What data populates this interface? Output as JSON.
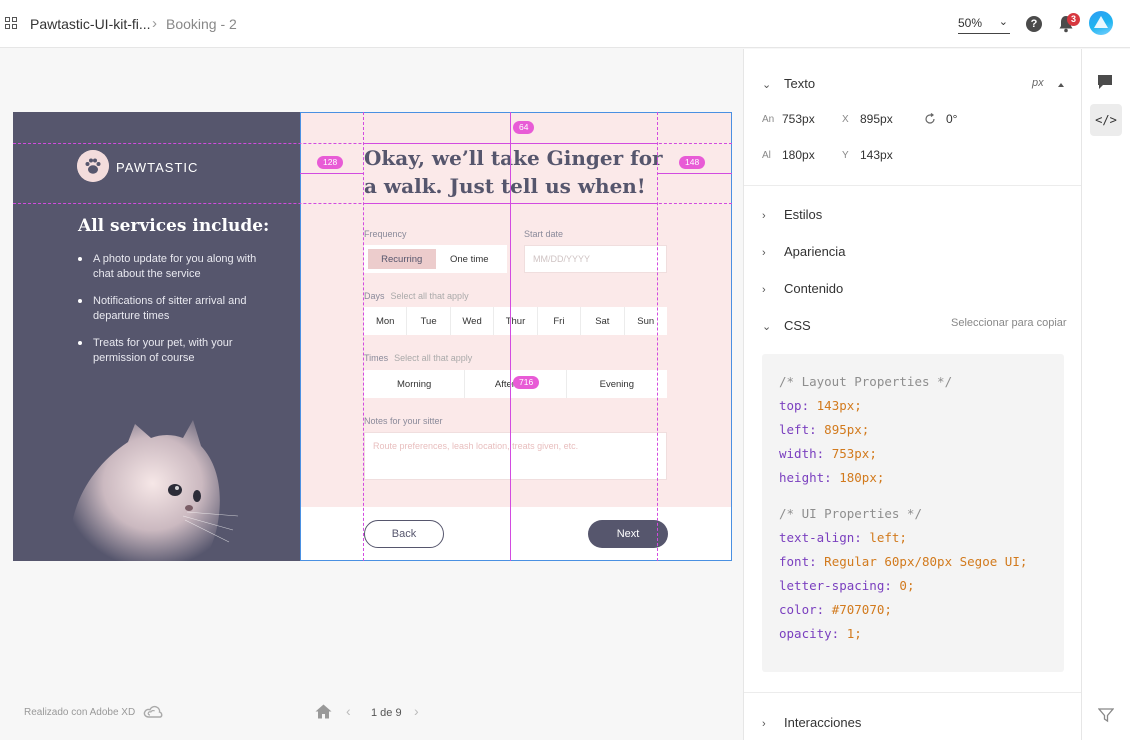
{
  "topbar": {
    "file_name": "Pawtastic-UI-kit-fi...",
    "page_name": "Booking - 2",
    "zoom": "50%",
    "notifications_count": "3",
    "icons": [
      "grid-icon",
      "help-icon",
      "bell-icon",
      "avatar"
    ]
  },
  "artboard": {
    "brand": "PAWTASTIC",
    "services_title": "All services include:",
    "services": [
      "A photo update for you along with chat about the service",
      "Notifications of sitter arrival and departure times",
      "Treats for your pet, with your permission of course"
    ],
    "headline": "Okay, we’ll take Ginger for a walk. Just tell us when!",
    "frequency_label": "Frequency",
    "frequency_options": [
      "Recurring",
      "One time"
    ],
    "start_date_label": "Start date",
    "start_date_placeholder": "MM/DD/YYYY",
    "days_label": "Days",
    "days_hint": "Select all that apply",
    "days": [
      "Mon",
      "Tue",
      "Wed",
      "Thur",
      "Fri",
      "Sat",
      "Sun"
    ],
    "times_label": "Times",
    "times_hint": "Select all that apply",
    "times": [
      "Morning",
      "Afternoon",
      "Evening"
    ],
    "notes_label": "Notes for your sitter",
    "notes_placeholder": "Route preferences, leash location, treats given, etc.",
    "back_label": "Back",
    "next_label": "Next",
    "colors": {
      "panel": "#56566d",
      "pink": "#fbe9e9",
      "selected": "#eccccc"
    }
  },
  "guides": {
    "top": "64",
    "left": "128",
    "right": "148",
    "width": "716"
  },
  "footer": {
    "made_with": "Realizado con Adobe XD",
    "page_count": "1 de 9"
  },
  "inspector": {
    "texto_title": "Texto",
    "unit": "px",
    "width_key": "An",
    "width_val": "753px",
    "x_key": "X",
    "x_val": "895px",
    "rotation_val": "0°",
    "height_key": "Al",
    "height_val": "180px",
    "y_key": "Y",
    "y_val": "143px",
    "sections": [
      "Estilos",
      "Apariencia",
      "Contenido",
      "CSS"
    ],
    "copy_label": "Seleccionar para copiar",
    "css_code": {
      "comment1": "/* Layout Properties */",
      "top_k": "top:",
      "top_v": "143px;",
      "left_k": "left:",
      "left_v": "895px;",
      "width_k": "width:",
      "width_v": "753px;",
      "height_k": "height:",
      "height_v": "180px;",
      "comment2": "/* UI Properties */",
      "align_k": "text-align:",
      "align_v": "left;",
      "font_k": "font:",
      "font_v": "Regular 60px/80px Segoe UI;",
      "spacing_k": "letter-spacing:",
      "spacing_v": "0;",
      "color_k": "color:",
      "color_v": "#707070;",
      "opacity_k": "opacity:",
      "opacity_v": "1;"
    },
    "interactions": "Interacciones"
  },
  "rail": {
    "code_tab": "</>"
  }
}
